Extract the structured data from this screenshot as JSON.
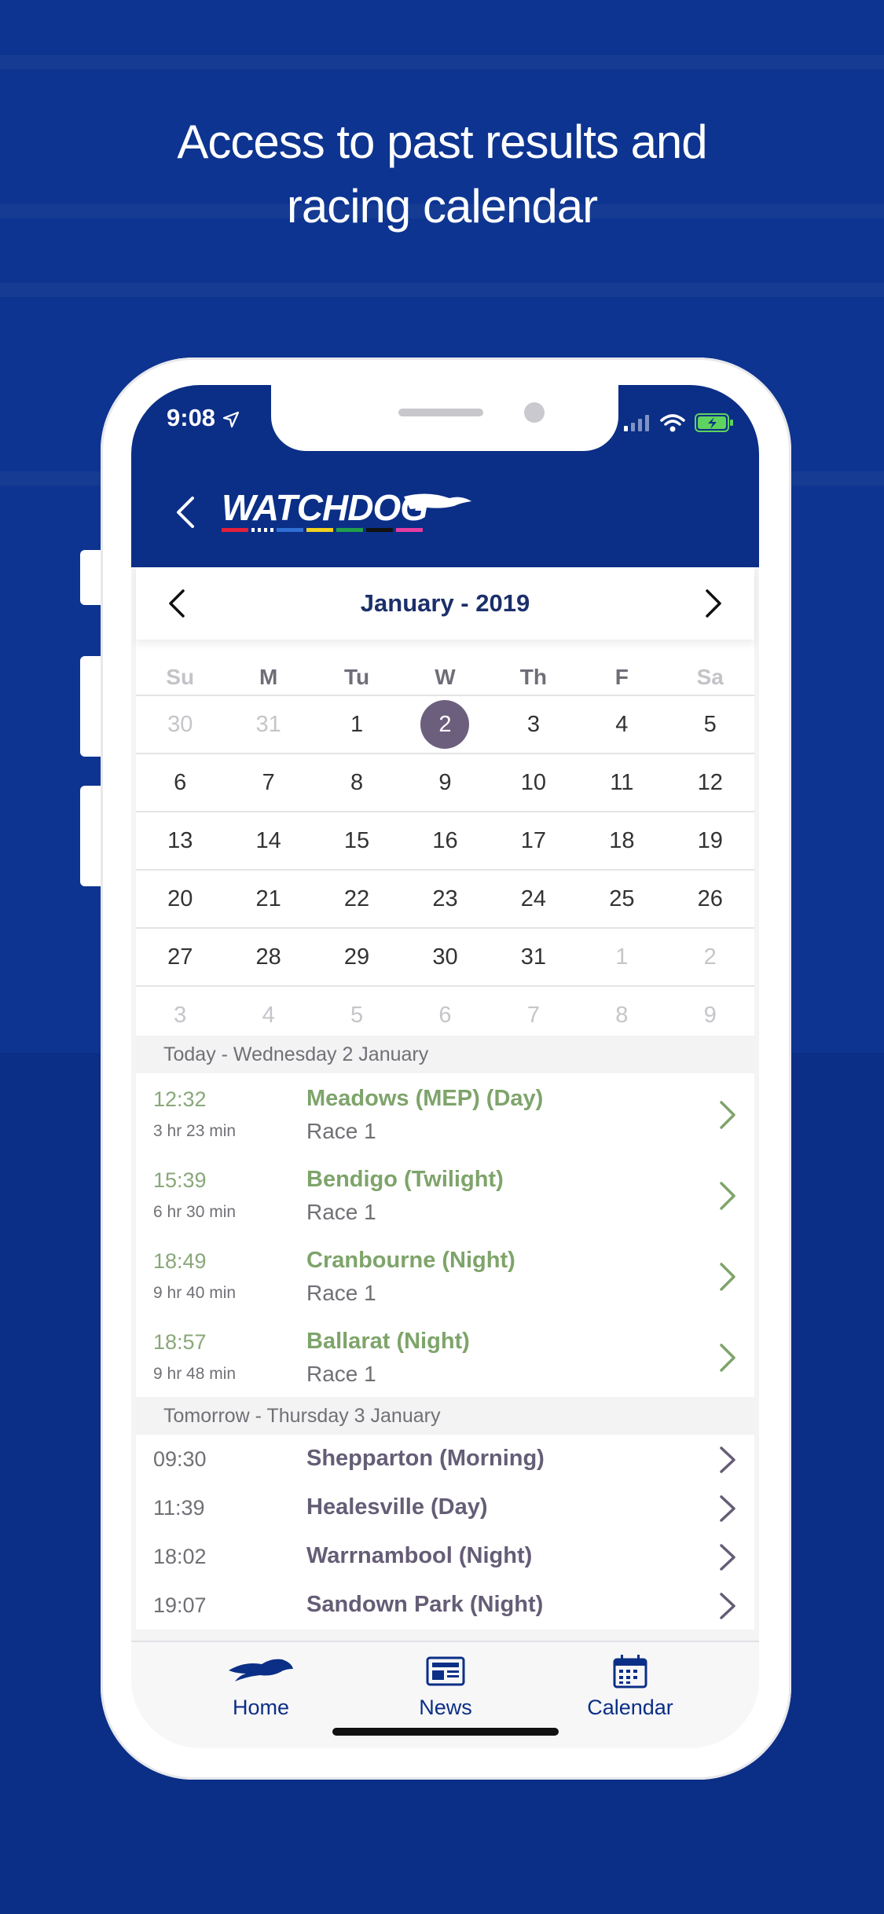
{
  "headline": {
    "line1": "Access to past results and",
    "line2": "racing calendar"
  },
  "status_bar": {
    "time": "9:08"
  },
  "header": {
    "logo_text": "WATCHDOG"
  },
  "calendar": {
    "month_label": "January - 2019",
    "weekdays": [
      "Su",
      "M",
      "Tu",
      "W",
      "Th",
      "F",
      "Sa"
    ],
    "weeks": [
      [
        "30",
        "31",
        "1",
        "2",
        "3",
        "4",
        "5"
      ],
      [
        "6",
        "7",
        "8",
        "9",
        "10",
        "11",
        "12"
      ],
      [
        "13",
        "14",
        "15",
        "16",
        "17",
        "18",
        "19"
      ],
      [
        "20",
        "21",
        "22",
        "23",
        "24",
        "25",
        "26"
      ],
      [
        "27",
        "28",
        "29",
        "30",
        "31",
        "1",
        "2"
      ],
      [
        "3",
        "4",
        "5",
        "6",
        "7",
        "8",
        "9"
      ]
    ],
    "selected_day": "2"
  },
  "today": {
    "header": "Today - Wednesday 2 January",
    "races": [
      {
        "time": "12:32",
        "countdown": "3 hr 23 min",
        "venue": "Meadows (MEP) (Day)",
        "race": "Race 1"
      },
      {
        "time": "15:39",
        "countdown": "6 hr 30 min",
        "venue": "Bendigo (Twilight)",
        "race": "Race 1"
      },
      {
        "time": "18:49",
        "countdown": "9 hr 40 min",
        "venue": "Cranbourne (Night)",
        "race": "Race 1"
      },
      {
        "time": "18:57",
        "countdown": "9 hr 48 min",
        "venue": "Ballarat (Night)",
        "race": "Race 1"
      }
    ]
  },
  "tomorrow": {
    "header": "Tomorrow - Thursday 3 January",
    "races": [
      {
        "time": "09:30",
        "venue": "Shepparton (Morning)"
      },
      {
        "time": "11:39",
        "venue": "Healesville (Day)"
      },
      {
        "time": "18:02",
        "venue": "Warrnambool (Night)"
      },
      {
        "time": "19:07",
        "venue": "Sandown Park (Night)"
      }
    ]
  },
  "tabs": {
    "home": "Home",
    "news": "News",
    "calendar": "Calendar"
  },
  "colors": {
    "brand": "#0b2f86",
    "today_green": "#7ea46a",
    "selected": "#6c5f7e"
  },
  "icons": {
    "back": "chevron-left-icon",
    "next": "chevron-right-icon",
    "home": "greyhound-icon",
    "news": "newspaper-icon",
    "calendar": "calendar-icon"
  }
}
